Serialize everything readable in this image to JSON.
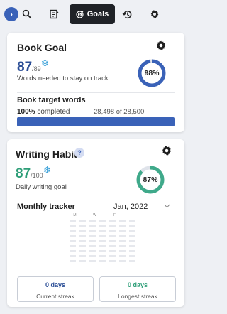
{
  "toolbar": {
    "collapse_icon": "chevron-right",
    "goals_label": "Goals"
  },
  "book_goal": {
    "title": "Book Goal",
    "count": "87",
    "count_total": "/89",
    "snowflake": "❄",
    "caption": "Words needed to stay on track",
    "ring_percent": 98,
    "ring_label": "98%",
    "target_title": "Book target words",
    "completed_percent": "100%",
    "completed_word": "completed",
    "words_summary": "28,498 of 28,500",
    "progress_fraction": 1.0
  },
  "writing_habit": {
    "title": "Writing Habit",
    "help": "?",
    "count": "87",
    "count_total": "/100",
    "snowflake": "❄",
    "caption": "Daily writing goal",
    "ring_percent": 87,
    "ring_label": "87%",
    "tracker_title": "Monthly tracker",
    "month": "Jan, 2022",
    "weekday_labels": [
      "M",
      "W",
      "F"
    ],
    "current_streak_value": "0 days",
    "current_streak_label": "Current streak",
    "longest_streak_value": "0 days",
    "longest_streak_label": "Longest streak"
  },
  "colors": {
    "accent_blue": "#3a62b8",
    "ring_green": "#3fa98a",
    "current_streak": "#2b4e96",
    "longest_streak": "#2e9e78"
  }
}
